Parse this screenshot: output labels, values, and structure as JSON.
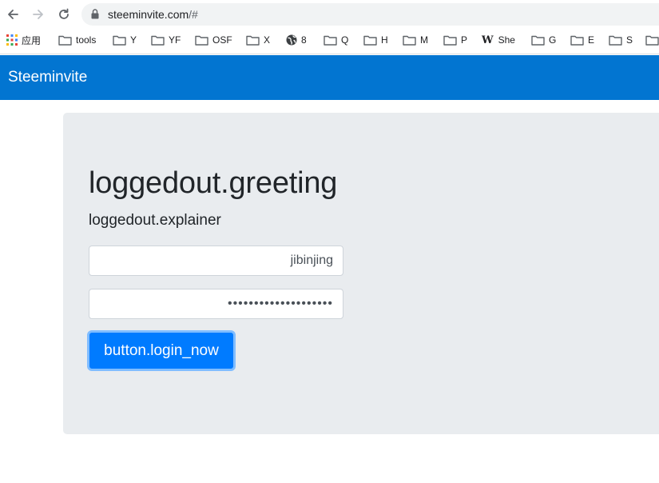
{
  "browser": {
    "url_host": "steeminvite.com",
    "url_path": "/#",
    "bookmarks": [
      {
        "label": "应用",
        "icon": "apps-grid-icon"
      },
      {
        "label": "tools",
        "icon": "folder-icon"
      },
      {
        "label": "Y",
        "icon": "folder-icon"
      },
      {
        "label": "YF",
        "icon": "folder-icon"
      },
      {
        "label": "OSF",
        "icon": "folder-icon"
      },
      {
        "label": "X",
        "icon": "folder-icon"
      },
      {
        "label": "8",
        "icon": "globe-icon"
      },
      {
        "label": "Q",
        "icon": "folder-icon"
      },
      {
        "label": "H",
        "icon": "folder-icon"
      },
      {
        "label": "M",
        "icon": "folder-icon"
      },
      {
        "label": "P",
        "icon": "folder-icon"
      },
      {
        "label": "She",
        "icon": "wikipedia-icon"
      },
      {
        "label": "G",
        "icon": "folder-icon"
      },
      {
        "label": "E",
        "icon": "folder-icon"
      },
      {
        "label": "S",
        "icon": "folder-icon"
      }
    ]
  },
  "app": {
    "brand": "Steeminvite",
    "greeting": "loggedout.greeting",
    "explainer": "loggedout.explainer",
    "username_value": "jibinjing",
    "password_value": "••••••••••••••••••••",
    "login_label": "button.login_now"
  },
  "colors": {
    "navbar": "#0275d1",
    "jumbotron": "#e9ecef",
    "primary_button": "#007bff",
    "button_focus_ring": "#80bdff"
  }
}
